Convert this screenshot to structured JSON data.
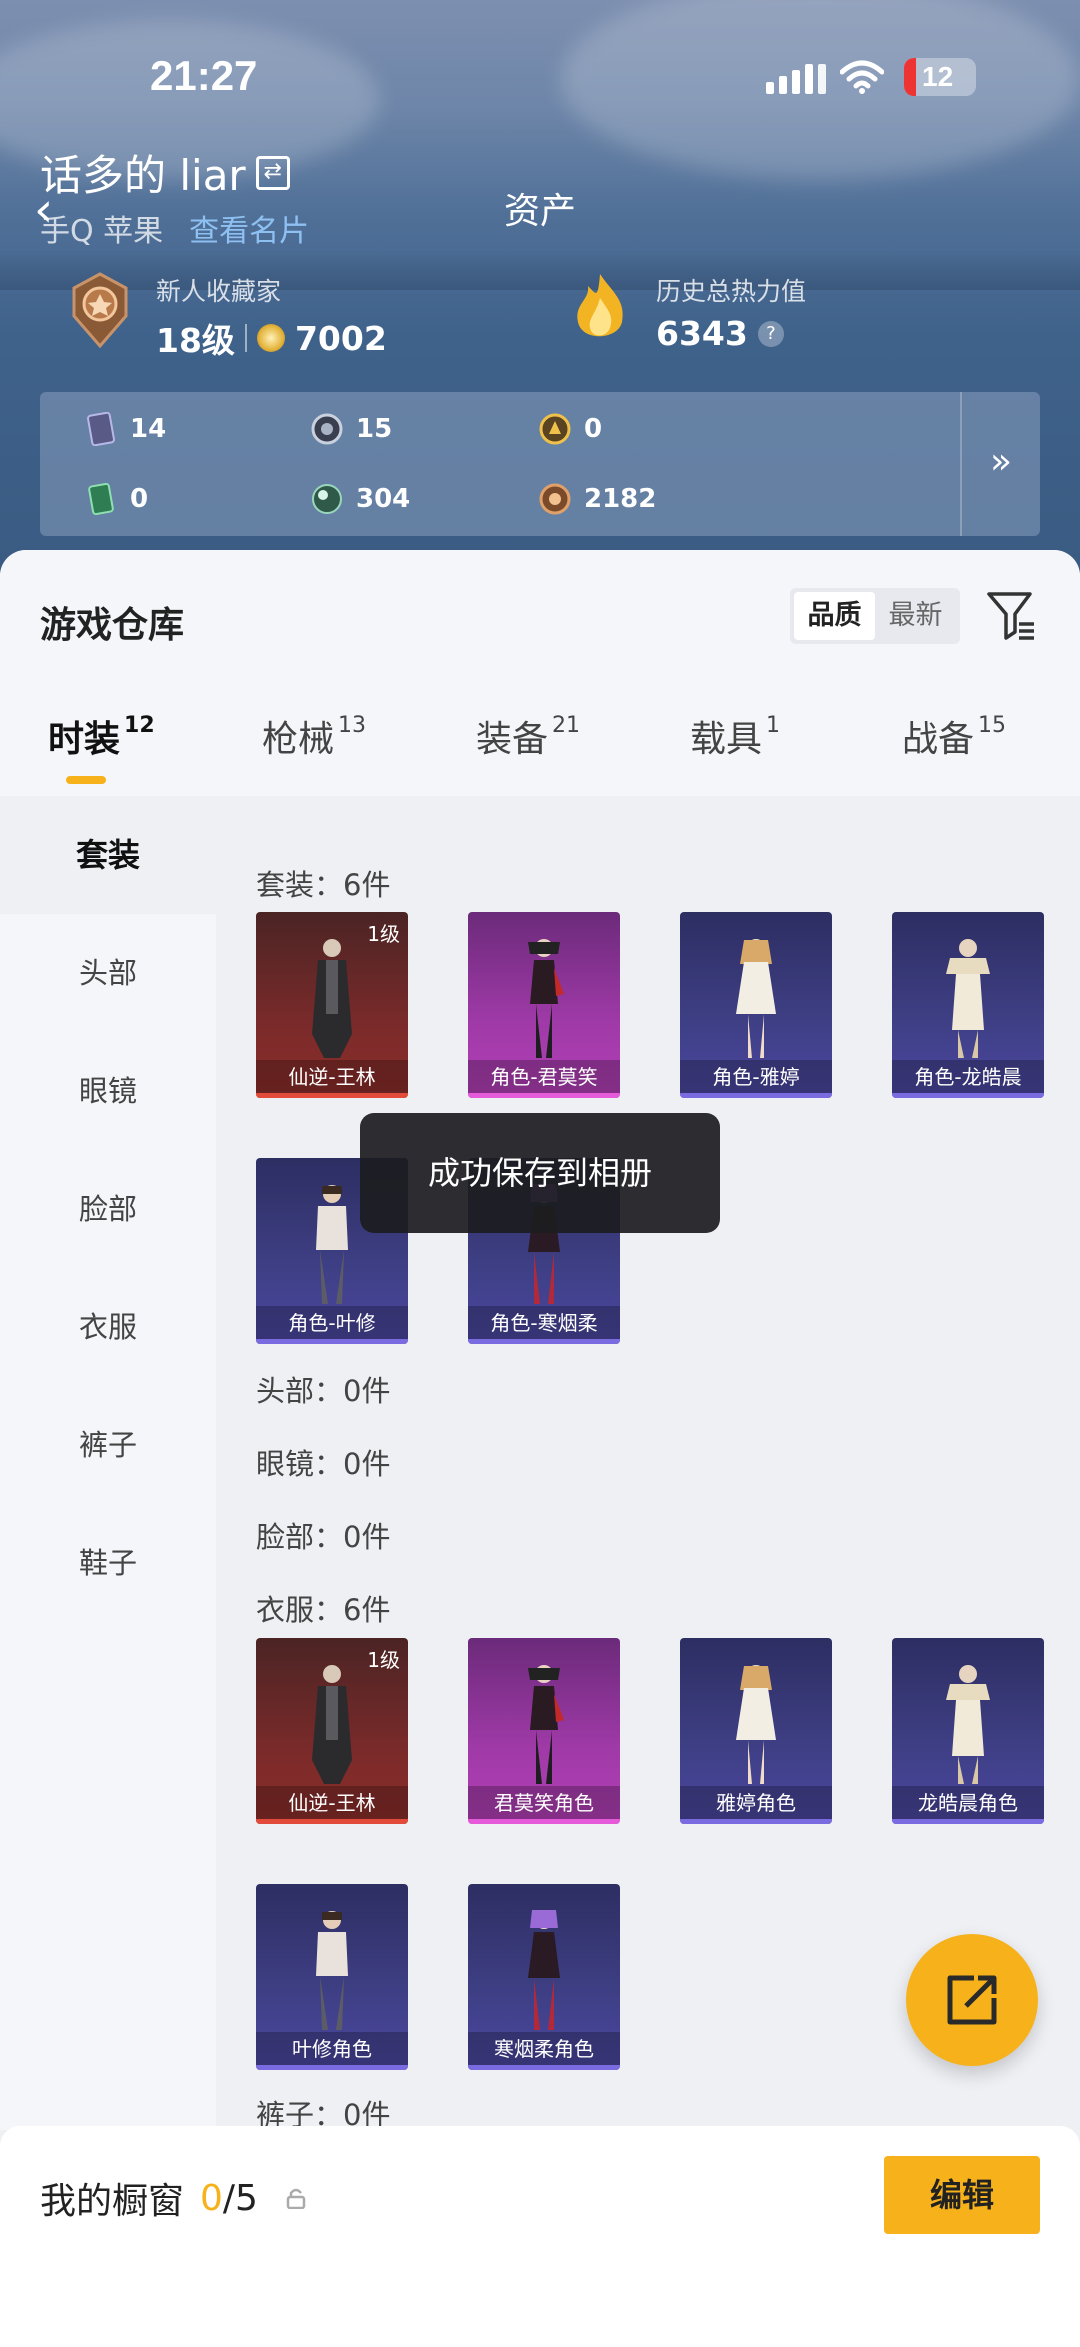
{
  "status_bar": {
    "time": "21:27",
    "battery": "12"
  },
  "header": {
    "username": "话多的 liar",
    "platform": "手Q 苹果",
    "platform_link": "查看名片",
    "title": "资产",
    "collector_label": "新人收藏家",
    "level": "18级",
    "coins": "7002",
    "heat_label": "历史总热力值",
    "heat_value": "6343"
  },
  "resources": [
    {
      "icon": "card-icon",
      "value": "14"
    },
    {
      "icon": "silver-coin-icon",
      "value": "15"
    },
    {
      "icon": "gold-coin-icon",
      "value": "0"
    },
    {
      "icon": "green-card-icon",
      "value": "0"
    },
    {
      "icon": "green-orb-icon",
      "value": "304"
    },
    {
      "icon": "bronze-coin-icon",
      "value": "2182"
    }
  ],
  "warehouse": {
    "title": "游戏仓库",
    "sort": [
      "品质",
      "最新"
    ],
    "tabs": [
      {
        "label": "时装",
        "count": "12"
      },
      {
        "label": "枪械",
        "count": "13"
      },
      {
        "label": "装备",
        "count": "21"
      },
      {
        "label": "载具",
        "count": "1"
      },
      {
        "label": "战备",
        "count": "15"
      }
    ],
    "side": [
      "套装",
      "头部",
      "眼镜",
      "脸部",
      "衣服",
      "裤子",
      "鞋子"
    ],
    "sections": {
      "suit": "套装：6件",
      "head": "头部：0件",
      "glasses": "眼镜：0件",
      "face": "脸部：0件",
      "clothes": "衣服：6件",
      "pants": "裤子：0件"
    },
    "suit_items": [
      {
        "name": "仙逆-王林",
        "level": "1级"
      },
      {
        "name": "角色-君莫笑"
      },
      {
        "name": "角色-雅婷"
      },
      {
        "name": "角色-龙皓晨"
      },
      {
        "name": "角色-叶修"
      },
      {
        "name": "角色-寒烟柔"
      }
    ],
    "clothes_items": [
      {
        "name": "仙逆-王林",
        "level": "1级"
      },
      {
        "name": "君莫笑角色"
      },
      {
        "name": "雅婷角色"
      },
      {
        "name": "龙皓晨角色"
      },
      {
        "name": "叶修角色"
      },
      {
        "name": "寒烟柔角色"
      }
    ]
  },
  "toast": "成功保存到相册",
  "showcase": {
    "label": "我的橱窗",
    "count": "0",
    "total": "/5",
    "edit": "编辑"
  },
  "colors": {
    "accent": "#f7b21b"
  }
}
